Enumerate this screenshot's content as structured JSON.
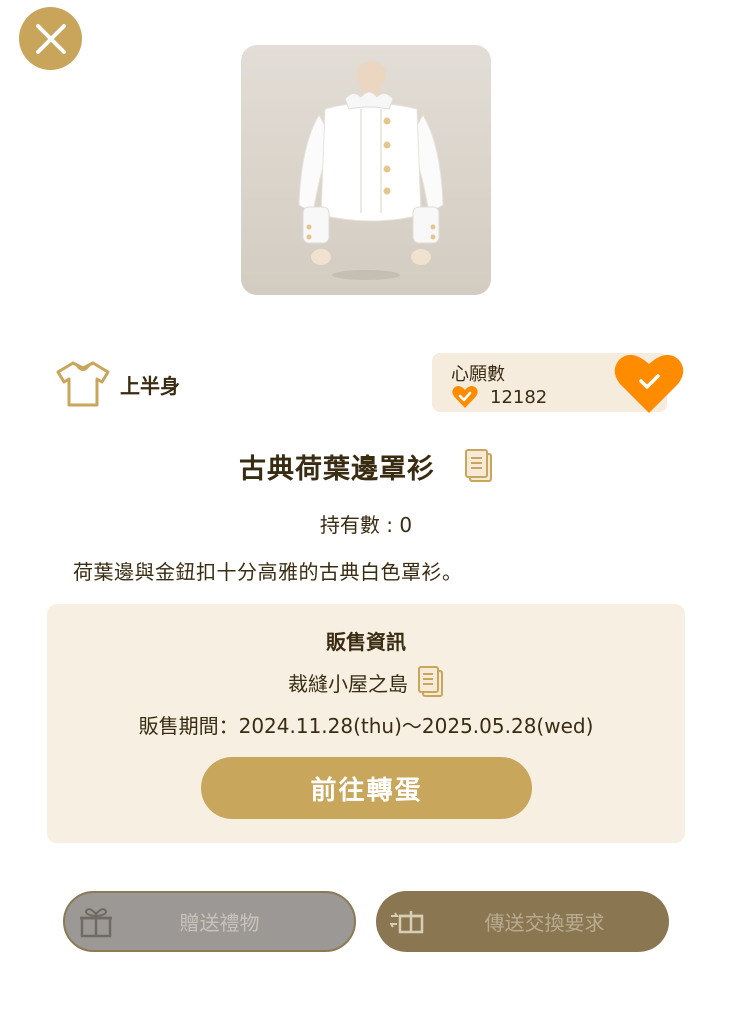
{
  "item": {
    "name": "古典荷葉邊罩衫",
    "category": "上半身",
    "owned": "持有數 : 0",
    "description": "荷葉邊與金鈕扣十分高雅的古典白色罩衫。"
  },
  "wish": {
    "label": "心願數",
    "count": "12182"
  },
  "sale": {
    "title": "販售資訊",
    "shop": "裁縫小屋之島",
    "period": "販售期間：2024.11.28(thu)～2025.05.28(wed)",
    "goto_label": "前往轉蛋"
  },
  "actions": {
    "gift_label": "贈送禮物",
    "trade_label": "傳送交換要求"
  },
  "icons": {
    "close": "close-icon",
    "category": "shirt-icon",
    "wish_small": "heart-check-icon",
    "wish_big": "heart-check-icon",
    "copy": "copy-icon",
    "gift": "gift-icon",
    "trade": "trade-icon"
  },
  "colors": {
    "accent_gold": "#c8a65c",
    "heart_orange": "#ff8c00",
    "panel_beige": "#f7efe2",
    "text_brown": "#3a2c12"
  }
}
